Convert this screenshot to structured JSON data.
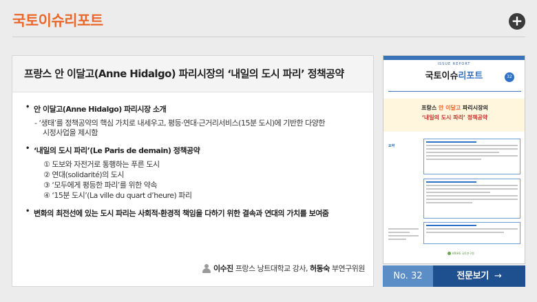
{
  "header": {
    "title": "국토이슈리포트",
    "more_button": "+"
  },
  "article": {
    "title": "프랑스 안 이달고(Anne Hidalgo) 파리시장의 ‘내일의 도시 파리’ 정책공약",
    "sections": [
      {
        "bullet": "안 이달고(Anne Hidalgo) 파리시장 소개",
        "subs": [
          "- ‘생태’를 정책공약의 핵심 가치로 내세우고, 평등·연대·근거리서비스(15분 도시)에 기반한 다양한",
          "시정사업을 제시함"
        ]
      },
      {
        "bullet": "‘내일의 도시 파리’(Le Paris de demain) 정책공약",
        "items": [
          "① 도보와 자전거로 통행하는 푸른 도시",
          "② 연대(solidarité)의 도시",
          "③ ‘모두에게 평등한 파리’를 위한 약속",
          "④ ‘15분 도시’(La ville du quart d’heure) 파리"
        ]
      },
      {
        "bullet": "변화의 최전선에 있는 도시 파리는 사회적·환경적 책임을 다하기 위한 결속과 연대의 가치를 보여줌"
      }
    ],
    "authors": {
      "name1": "이수진",
      "role1": "프랑스 낭트대학교 강사,",
      "name2": "허동숙",
      "role2": "부연구위원"
    }
  },
  "cover": {
    "tag": "ISSUE REPORT",
    "title_main": "국토이슈",
    "title_accent": "리포트",
    "badge": "32",
    "band_line1_a": "프랑스",
    "band_line1_b": "안 이달고",
    "band_line1_c": "파리시장의",
    "band_line2": "‘내일의 도시 파리’ 정책공약",
    "summary_label": "요약",
    "logo_text": "KRIHS 국토연구원"
  },
  "footer": {
    "number_label": "No. 32",
    "view_button": "전문보기",
    "view_arrow": "→"
  },
  "colors": {
    "accent_orange": "#e9682a",
    "navy": "#1e4f8f",
    "blue": "#5b8ec6"
  }
}
